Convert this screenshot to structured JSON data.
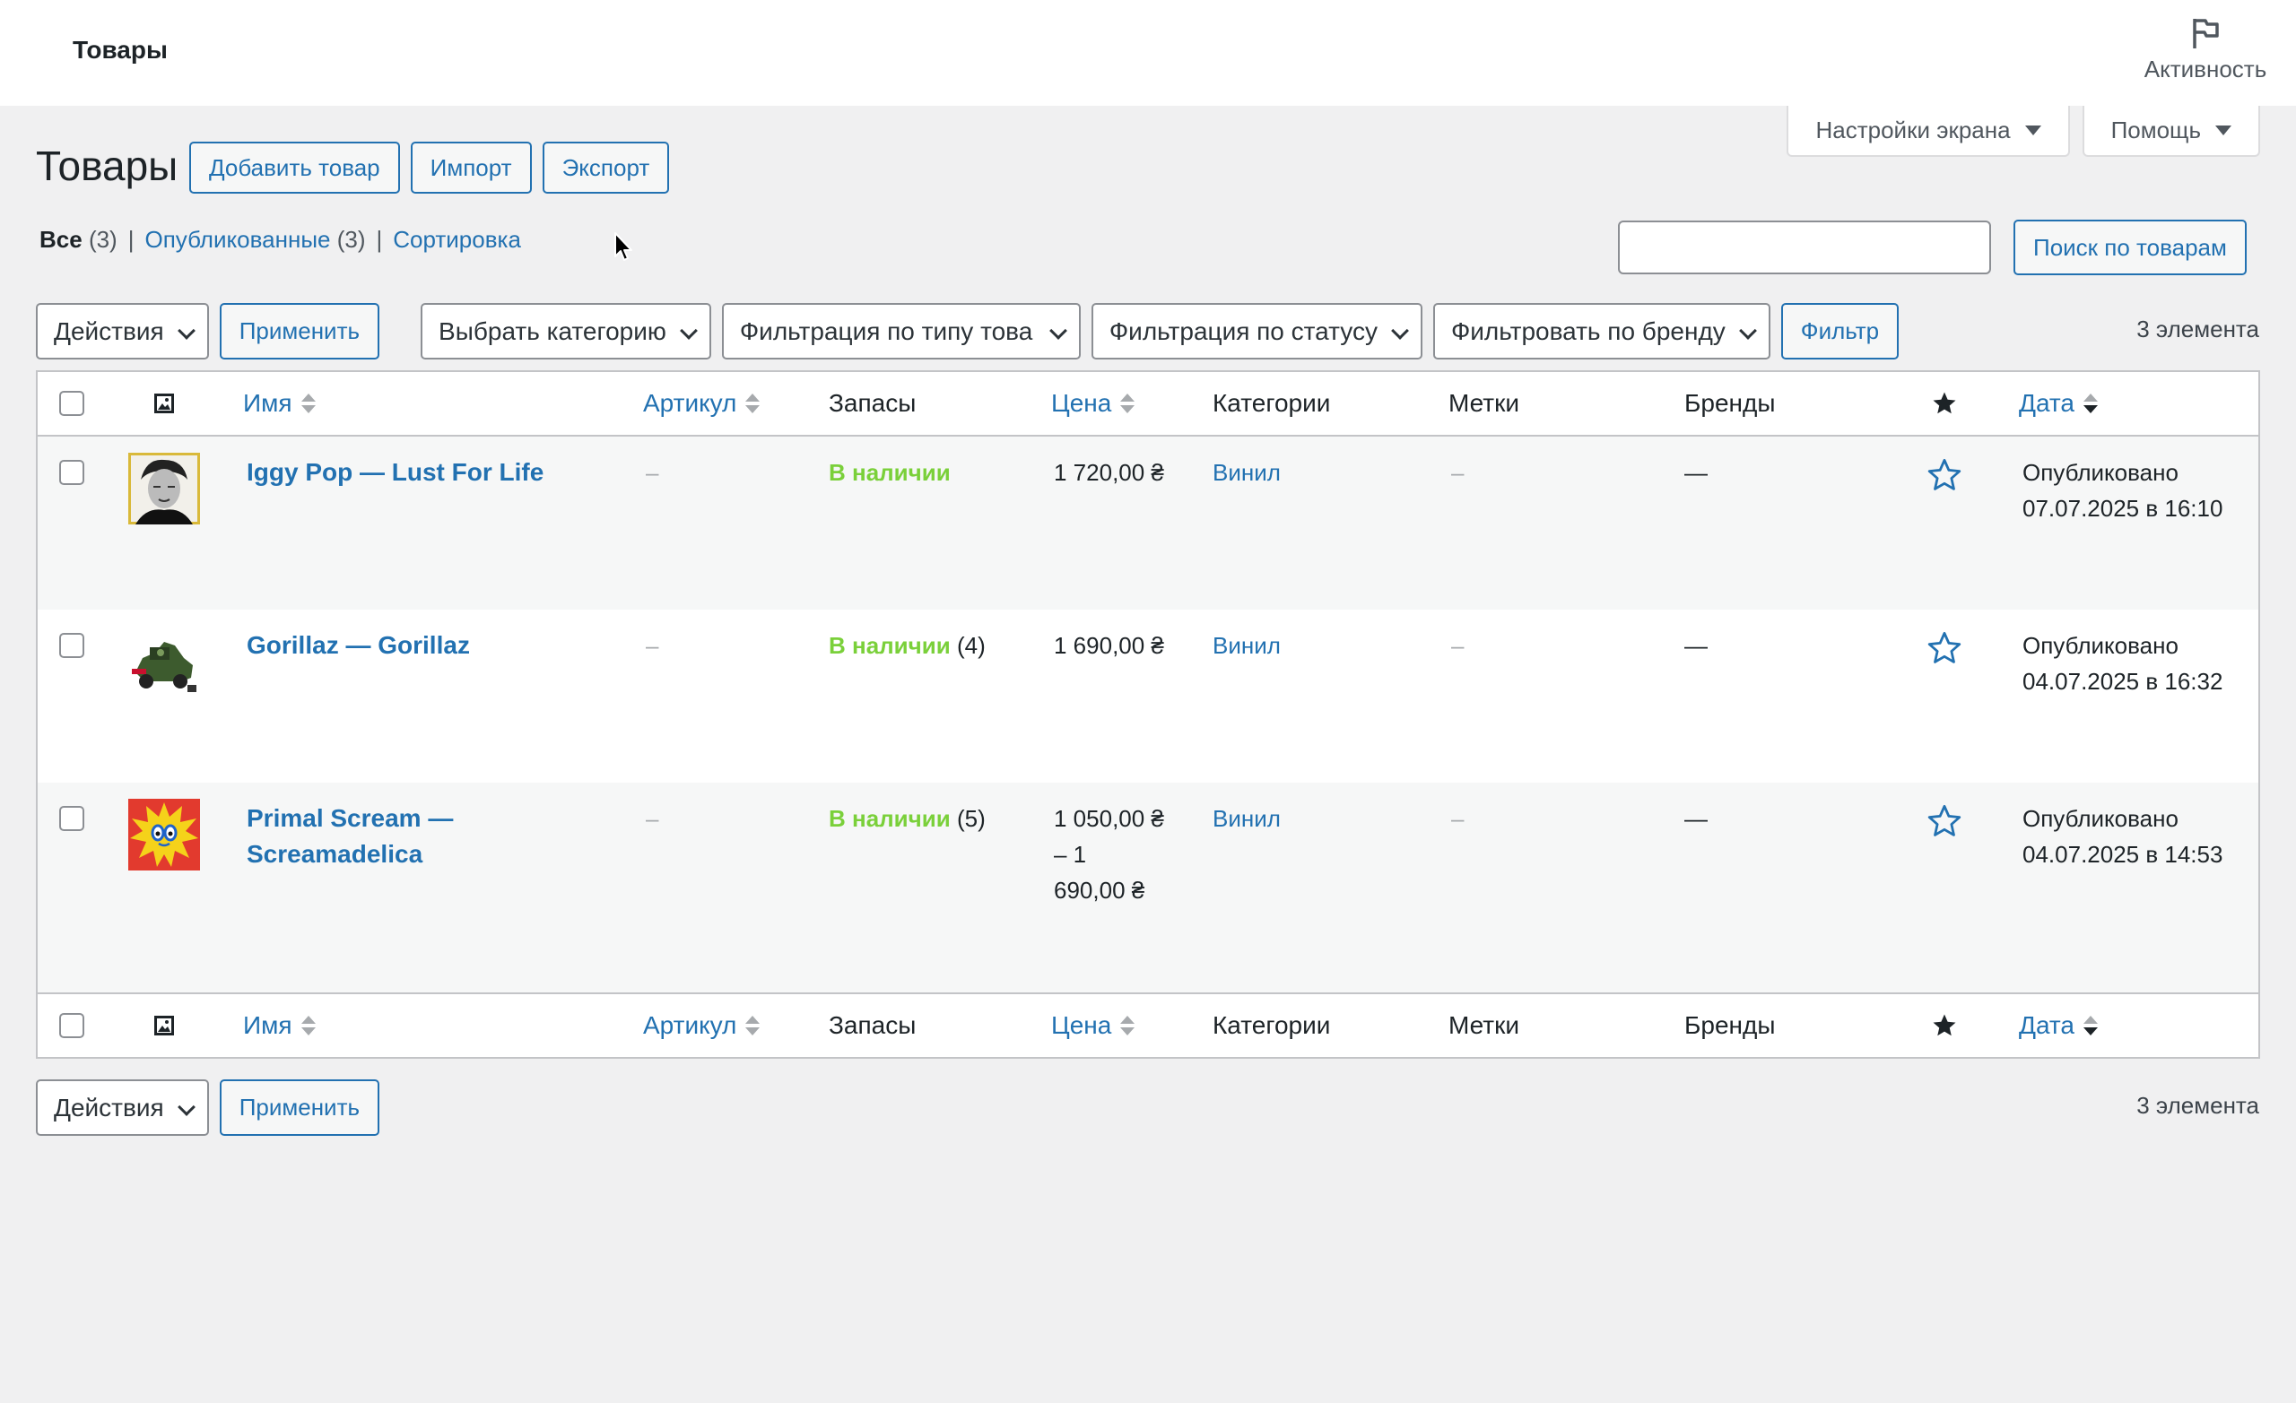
{
  "topbar": {
    "title": "Товары",
    "activity_label": "Активность"
  },
  "screen_options": {
    "screen_settings": "Настройки экрана",
    "help": "Помощь"
  },
  "page": {
    "title": "Товары"
  },
  "header_buttons": {
    "add": "Добавить товар",
    "import": "Импорт",
    "export": "Экспорт"
  },
  "views": {
    "all_label": "Все",
    "all_count": "(3)",
    "published_label": "Опубликованные",
    "published_count": "(3)",
    "sort_label": "Сортировка",
    "sep": "|"
  },
  "search": {
    "value": "",
    "button": "Поиск по товарам"
  },
  "tablenav_top": {
    "bulk_action": "Действия",
    "apply": "Применить",
    "category_filter": "Выбрать категорию",
    "type_filter": "Фильтрация по типу това",
    "status_filter": "Фильтрация по статусу",
    "brand_filter": "Фильтровать по бренду",
    "filter_button": "Фильтр",
    "count": "3 элемента"
  },
  "tablenav_bottom": {
    "bulk_action": "Действия",
    "apply": "Применить",
    "count": "3 элемента"
  },
  "columns": {
    "name": "Имя",
    "sku": "Артикул",
    "stock": "Запасы",
    "price": "Цена",
    "categories": "Категории",
    "tags": "Метки",
    "brands": "Бренды",
    "date": "Дата"
  },
  "icons": {
    "thumb_header": "image-icon",
    "featured_header": "star-filled-icon",
    "featured_row": "star-outline-icon",
    "sort": "sort-arrows-icon",
    "activity": "flag-icon"
  },
  "colors": {
    "link": "#2271b1",
    "instock": "#7ad03a",
    "border": "#c3c4c7",
    "background": "#f0f0f1"
  },
  "rows": [
    {
      "name": "Iggy Pop — Lust For Life",
      "sku": "–",
      "stock_status": "В наличии",
      "stock_qty": "",
      "price_line1": "1 720,00 ₴",
      "price_line2": "",
      "price_line3": "",
      "category": "Винил",
      "tags": "–",
      "brands": "—",
      "date_status": "Опубликовано",
      "date": "07.07.2025 в 16:10"
    },
    {
      "name": "Gorillaz — Gorillaz",
      "sku": "–",
      "stock_status": "В наличии",
      "stock_qty": "(4)",
      "price_line1": "1 690,00 ₴",
      "price_line2": "",
      "price_line3": "",
      "category": "Винил",
      "tags": "–",
      "brands": "—",
      "date_status": "Опубликовано",
      "date": "04.07.2025 в 16:32"
    },
    {
      "name_line1": "Primal Scream —",
      "name_line2": "Screamadelica",
      "sku": "–",
      "stock_status": "В наличии",
      "stock_qty": "(5)",
      "price_line1": "1 050,00 ₴",
      "price_line2": "– 1",
      "price_line3": "690,00 ₴",
      "category": "Винил",
      "tags": "–",
      "brands": "—",
      "date_status": "Опубликовано",
      "date": "04.07.2025 в 14:53"
    }
  ]
}
